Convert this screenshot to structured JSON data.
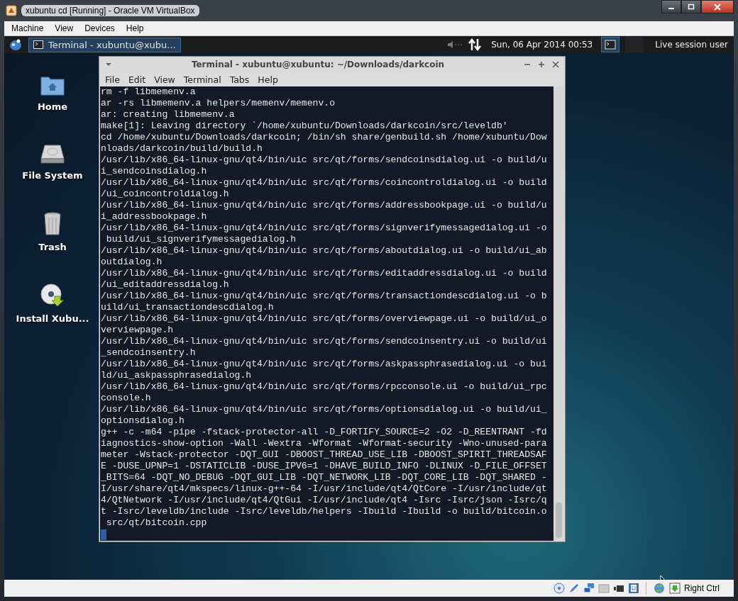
{
  "window": {
    "title": "xubuntu cd [Running] - Oracle VM VirtualBox"
  },
  "menu": [
    "Machine",
    "View",
    "Devices",
    "Help"
  ],
  "panel": {
    "task": {
      "label": "Terminal - xubuntu@xubu...",
      "selected": true
    },
    "clock": "Sun, 06 Apr 2014 00:53",
    "user": "Live session user"
  },
  "desktop_icons": [
    {
      "kind": "home",
      "label": "Home"
    },
    {
      "kind": "drive",
      "label": "File System"
    },
    {
      "kind": "trash",
      "label": "Trash"
    },
    {
      "kind": "disc",
      "label": "Install Xubu..."
    }
  ],
  "terminal": {
    "title": "Terminal - xubuntu@xubuntu: ~/Downloads/darkcoin",
    "menu": [
      "File",
      "Edit",
      "View",
      "Terminal",
      "Tabs",
      "Help"
    ],
    "lines": [
      "rm -f libmemenv.a",
      "ar -rs libmemenv.a helpers/memenv/memenv.o",
      "ar: creating libmemenv.a",
      "make[1]: Leaving directory `/home/xubuntu/Downloads/darkcoin/src/leveldb'",
      "cd /home/xubuntu/Downloads/darkcoin; /bin/sh share/genbuild.sh /home/xubuntu/Dow",
      "nloads/darkcoin/build/build.h",
      "/usr/lib/x86_64-linux-gnu/qt4/bin/uic src/qt/forms/sendcoinsdialog.ui -o build/u",
      "i_sendcoinsdialog.h",
      "/usr/lib/x86_64-linux-gnu/qt4/bin/uic src/qt/forms/coincontroldialog.ui -o build",
      "/ui_coincontroldialog.h",
      "/usr/lib/x86_64-linux-gnu/qt4/bin/uic src/qt/forms/addressbookpage.ui -o build/u",
      "i_addressbookpage.h",
      "/usr/lib/x86_64-linux-gnu/qt4/bin/uic src/qt/forms/signverifymessagedialog.ui -o",
      " build/ui_signverifymessagedialog.h",
      "/usr/lib/x86_64-linux-gnu/qt4/bin/uic src/qt/forms/aboutdialog.ui -o build/ui_ab",
      "outdialog.h",
      "/usr/lib/x86_64-linux-gnu/qt4/bin/uic src/qt/forms/editaddressdialog.ui -o build",
      "/ui_editaddressdialog.h",
      "/usr/lib/x86_64-linux-gnu/qt4/bin/uic src/qt/forms/transactiondescdialog.ui -o b",
      "uild/ui_transactiondescdialog.h",
      "/usr/lib/x86_64-linux-gnu/qt4/bin/uic src/qt/forms/overviewpage.ui -o build/ui_o",
      "verviewpage.h",
      "/usr/lib/x86_64-linux-gnu/qt4/bin/uic src/qt/forms/sendcoinsentry.ui -o build/ui",
      "_sendcoinsentry.h",
      "/usr/lib/x86_64-linux-gnu/qt4/bin/uic src/qt/forms/askpassphrasedialog.ui -o bui",
      "ld/ui_askpassphrasedialog.h",
      "/usr/lib/x86_64-linux-gnu/qt4/bin/uic src/qt/forms/rpcconsole.ui -o build/ui_rpc",
      "console.h",
      "/usr/lib/x86_64-linux-gnu/qt4/bin/uic src/qt/forms/optionsdialog.ui -o build/ui_",
      "optionsdialog.h",
      "g++ -c -m64 -pipe -fstack-protector-all -D_FORTIFY_SOURCE=2 -O2 -D_REENTRANT -fd",
      "iagnostics-show-option -Wall -Wextra -Wformat -Wformat-security -Wno-unused-para",
      "meter -Wstack-protector -DQT_GUI -DBOOST_THREAD_USE_LIB -DBOOST_SPIRIT_THREADSAF",
      "E -DUSE_UPNP=1 -DSTATICLIB -DUSE_IPV6=1 -DHAVE_BUILD_INFO -DLINUX -D_FILE_OFFSET",
      "_BITS=64 -DQT_NO_DEBUG -DQT_GUI_LIB -DQT_NETWORK_LIB -DQT_CORE_LIB -DQT_SHARED -",
      "I/usr/share/qt4/mkspecs/linux-g++-64 -I/usr/include/qt4/QtCore -I/usr/include/qt",
      "4/QtNetwork -I/usr/include/qt4/QtGui -I/usr/include/qt4 -Isrc -Isrc/json -Isrc/q",
      "t -Isrc/leveldb/include -Isrc/leveldb/helpers -Ibuild -Ibuild -o build/bitcoin.o",
      " src/qt/bitcoin.cpp"
    ]
  },
  "status_bar": {
    "host_key": "Right Ctrl"
  }
}
